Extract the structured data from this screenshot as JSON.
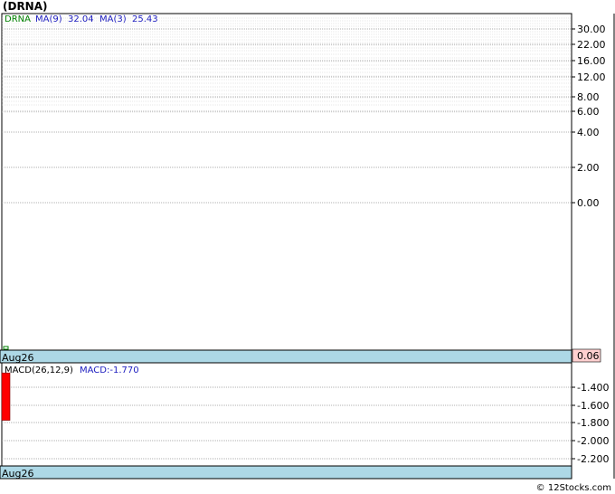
{
  "title": "(DRNA)",
  "copyright": "© 12Stocks.com",
  "chart_data": [
    {
      "type": "line",
      "panel": "price",
      "legend": [
        {
          "text": "DRNA",
          "color": "#008000"
        },
        {
          "text": "MA(9)",
          "color": "#2020c0"
        },
        {
          "text": "32.04",
          "color": "#2020c0"
        },
        {
          "text": "MA(3)",
          "color": "#2020c0"
        },
        {
          "text": "25.43",
          "color": "#2020c0"
        }
      ],
      "yticks": [
        "30.00",
        "22.00",
        "16.00",
        "12.00",
        "8.00",
        "6.00",
        "4.00",
        "2.00",
        "0.00"
      ],
      "x_label": "Aug26",
      "last_value": "0.06",
      "last_value_bg": "#ffd0d0"
    },
    {
      "type": "bar",
      "panel": "macd",
      "legend": [
        {
          "text": "MACD(26,12,9)",
          "color": "#000000"
        },
        {
          "text": "MACD:-1.770",
          "color": "#2020c0"
        }
      ],
      "yticks": [
        "-1.400",
        "-1.600",
        "-1.800",
        "-2.000",
        "-2.200"
      ],
      "ylim": [
        -2.3,
        -1.2
      ],
      "bars": [
        {
          "x": "Aug26",
          "top": -1.24,
          "bottom": -1.77,
          "color": "#ff0000"
        }
      ],
      "x_label": "Aug26"
    }
  ],
  "colors": {
    "axis_bar": "#add8e6",
    "grid": "#999999"
  }
}
